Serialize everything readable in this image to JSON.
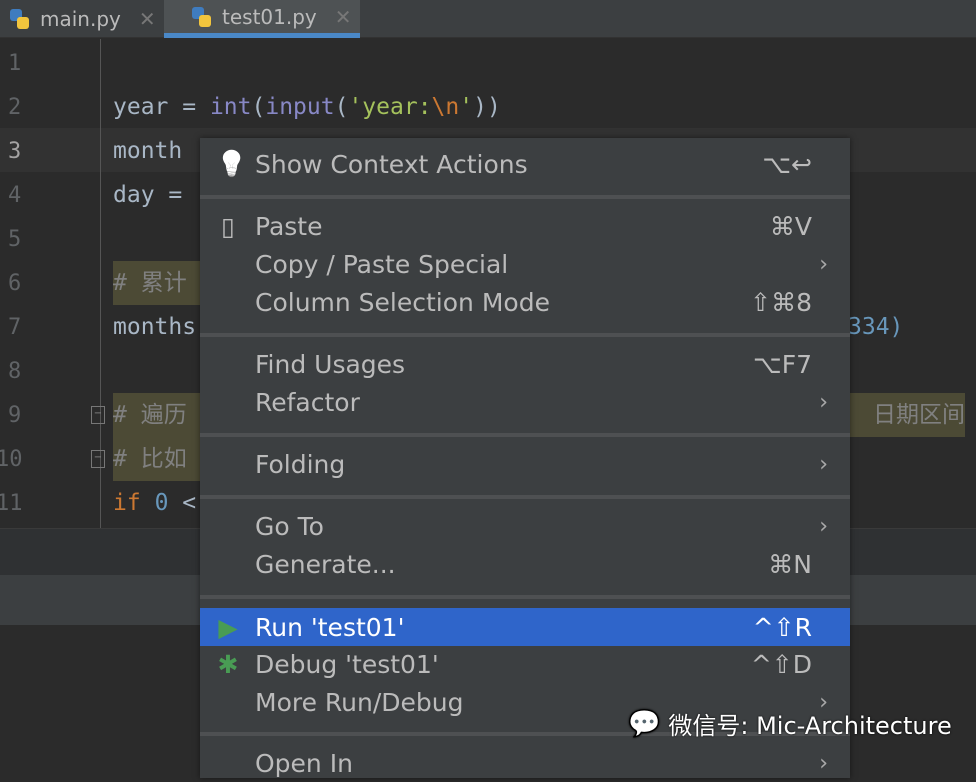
{
  "tabs": [
    {
      "label": "main.py",
      "active": false
    },
    {
      "label": "test01.py",
      "active": true
    }
  ],
  "editor": {
    "line_numbers": [
      "1",
      "2",
      "3",
      "4",
      "5",
      "6",
      "7",
      "8",
      "9",
      "10",
      "11"
    ],
    "current_line": "3",
    "lines": {
      "l2": {
        "a": "year = ",
        "b": "int",
        "c": "(",
        "d": "input",
        "e": "(",
        "f": "'year:",
        "g": "\\n",
        "h": "'",
        "i": "))"
      },
      "l3": "month",
      "l4": "day =",
      "l6": "# 累计",
      "l7": "months",
      "l7_right": "334)",
      "l9": "# 遍历",
      "l9_right": "日期区间",
      "l10": "# 比如",
      "l11_kw": "if",
      "l11_num": "0",
      "l11_rest": " <"
    }
  },
  "context_menu": {
    "items": [
      {
        "label": "Show Context Actions",
        "shortcut": "⌥↩",
        "icon": "lightbulb-icon"
      },
      {
        "label": "Paste",
        "shortcut": "⌘V",
        "icon": "clipboard-icon"
      },
      {
        "label": "Copy / Paste Special",
        "submenu": true
      },
      {
        "label": "Column Selection Mode",
        "shortcut": "⇧⌘8"
      },
      {
        "label": "Find Usages",
        "shortcut": "⌥F7"
      },
      {
        "label": "Refactor",
        "submenu": true
      },
      {
        "label": "Folding",
        "submenu": true
      },
      {
        "label": "Go To",
        "submenu": true
      },
      {
        "label": "Generate...",
        "shortcut": "⌘N"
      },
      {
        "label": "Run 'test01'",
        "shortcut": "^⇧R",
        "icon": "run-icon",
        "selected": true
      },
      {
        "label": "Debug 'test01'",
        "shortcut": "^⇧D",
        "icon": "debug-icon"
      },
      {
        "label": "More Run/Debug",
        "submenu": true
      },
      {
        "label": "Open In",
        "submenu": true
      }
    ],
    "submenu_arrow": "›"
  },
  "watermark": "微信号: Mic-Architecture",
  "colors": {
    "accent": "#2f65ca",
    "run": "#499c54",
    "tab_underline": "#4a88c7"
  }
}
